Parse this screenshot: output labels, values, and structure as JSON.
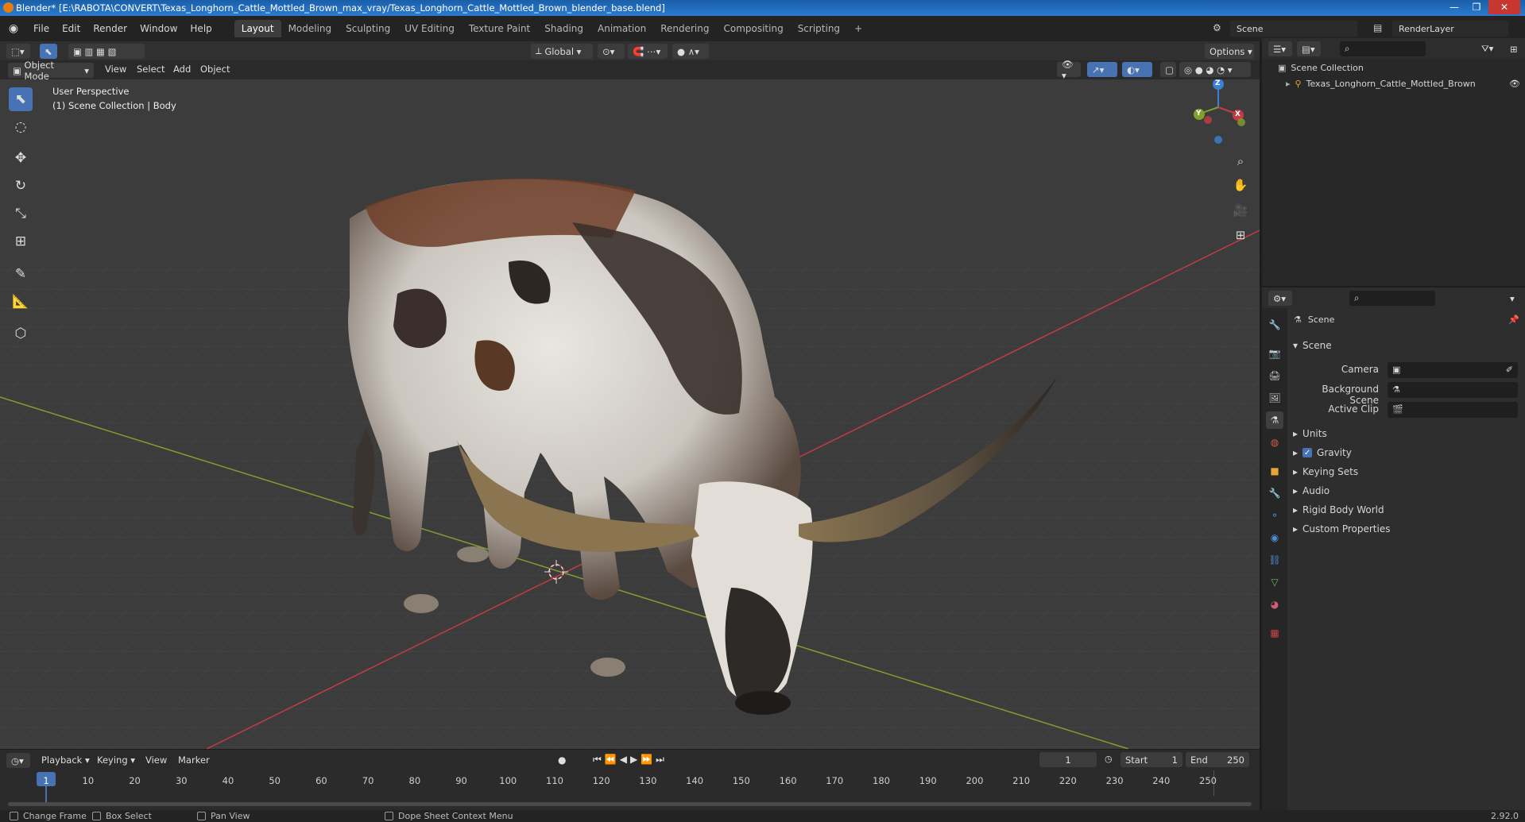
{
  "window": {
    "title": "Blender* [E:\\RABOTA\\CONVERT\\Texas_Longhorn_Cattle_Mottled_Brown_max_vray/Texas_Longhorn_Cattle_Mottled_Brown_blender_base.blend]"
  },
  "menu": [
    "File",
    "Edit",
    "Render",
    "Window",
    "Help"
  ],
  "workspaces": [
    {
      "label": "Layout",
      "active": true
    },
    {
      "label": "Modeling"
    },
    {
      "label": "Sculpting"
    },
    {
      "label": "UV Editing"
    },
    {
      "label": "Texture Paint"
    },
    {
      "label": "Shading"
    },
    {
      "label": "Animation"
    },
    {
      "label": "Rendering"
    },
    {
      "label": "Compositing"
    },
    {
      "label": "Scripting"
    }
  ],
  "add_workspace": "+",
  "scene_name": "Scene",
  "render_layer": "RenderLayer",
  "viewport": {
    "transform_orientation": "Global",
    "options_label": "Options",
    "mode": "Object Mode",
    "menus": [
      "View",
      "Select",
      "Add",
      "Object"
    ],
    "info_line1": "User Perspective",
    "info_line2": "(1) Scene Collection | Body",
    "gizmo": {
      "z": "Z",
      "y": "Y",
      "x": "X"
    }
  },
  "outliner": {
    "collection": "Scene Collection",
    "object": "Texas_Longhorn_Cattle_Mottled_Brown"
  },
  "properties": {
    "context": "Scene",
    "panel": "Scene",
    "camera_label": "Camera",
    "background_scene_label": "Background Scene",
    "active_clip_label": "Active Clip",
    "sections": [
      "Units",
      "Gravity",
      "Keying Sets",
      "Audio",
      "Rigid Body World",
      "Custom Properties"
    ]
  },
  "timeline": {
    "menus": [
      "Playback",
      "Keying",
      "View",
      "Marker"
    ],
    "current_frame": "1",
    "start_label": "Start",
    "start": "1",
    "end_label": "End",
    "end": "250",
    "ticks": [
      "1",
      "10",
      "20",
      "30",
      "40",
      "50",
      "60",
      "70",
      "80",
      "90",
      "100",
      "110",
      "120",
      "130",
      "140",
      "150",
      "160",
      "170",
      "180",
      "190",
      "200",
      "210",
      "220",
      "230",
      "240",
      "250"
    ]
  },
  "statusbar": {
    "item1": "Change Frame",
    "item2": "Box Select",
    "item3": "Pan View",
    "item4": "Dope Sheet Context Menu",
    "version": "2.92.0"
  },
  "colors": {
    "accent": "#4772b3",
    "x_axis": "#c33c45",
    "y_axis": "#7fa02c",
    "z_axis": "#3b7fd6"
  }
}
